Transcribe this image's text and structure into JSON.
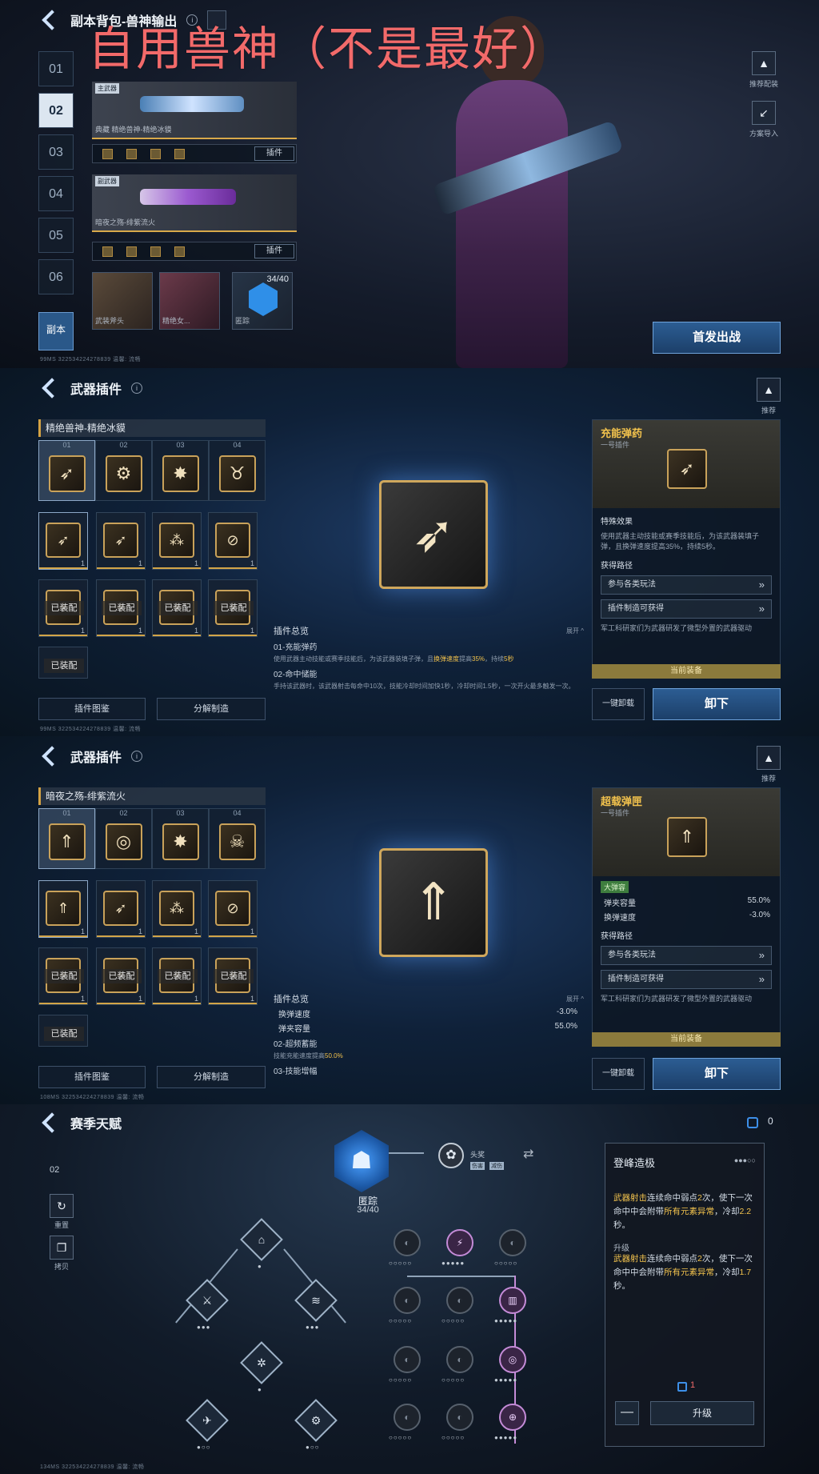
{
  "overlay_title": "自用兽神（不是最好）",
  "p1": {
    "title": "副本背包-兽神输出",
    "slots": [
      "01",
      "02",
      "03",
      "04",
      "05",
      "06"
    ],
    "weapon1": {
      "tag": "主武器",
      "name": "典藏 精绝兽神-精绝冰貘",
      "plugin_btn": "插件"
    },
    "weapon2": {
      "tag": "副武器",
      "name": "暗夜之殇-绯紫流火",
      "plugin_btn": "插件"
    },
    "minis": [
      {
        "label": "武装斧头"
      },
      {
        "label": "精绝女..."
      },
      {
        "label": "匿踪"
      }
    ],
    "mini_count": "34/40",
    "side_recommend": "推荐配装",
    "side_import": "方案导入",
    "dungeon_btn": "副本",
    "fight_btn": "首发出战",
    "footer": "99MS 322534224278839   温馨: 流畅"
  },
  "p2": {
    "title": "武器插件",
    "recommend": "推荐",
    "weapon_label": "精绝兽神-精绝冰貘",
    "tabs": [
      "01",
      "02",
      "03",
      "04"
    ],
    "equipped_label": "已装配",
    "btn_atlas": "插件图鉴",
    "btn_craft": "分解制造",
    "summary_title": "插件总览",
    "expand": "展开 ^",
    "sum1_title": "01-充能弹药",
    "sum1_text_a": "使用武器主动技能或赛季技能后，为该武器装填子弹，且",
    "sum1_hl": "换弹速度",
    "sum1_text_b": "提高",
    "sum1_val": "35%",
    "sum1_text_c": "，持续",
    "sum1_dur": "5秒",
    "sum2_title": "02-命中储能",
    "sum2_text": "手持该武器时，该武器射击每命中10次，技能冷却时间加快1秒，冷却时间1.5秒，一次开火最多触发一次。",
    "detail_name": "充能弹药",
    "detail_sub": "一号插件",
    "sec_effect": "特殊效果",
    "effect_text": "使用武器主动技能或赛季技能后，为该武器装填子弹，且换弹速度提高35%，持续5秒。",
    "sec_source": "获得路径",
    "src1": "参与各类玩法",
    "src2": "插件制造可获得",
    "lore": "军工科研家们为武器研发了微型外置的武器驱动",
    "current": "当前装备",
    "onekey": "一键卸载",
    "unload": "卸下",
    "footer": "99MS 322534224278839   温馨: 流畅"
  },
  "p3": {
    "title": "武器插件",
    "recommend": "推荐",
    "weapon_label": "暗夜之殇-绯紫流火",
    "tabs": [
      "01",
      "02",
      "03",
      "04"
    ],
    "equipped_label": "已装配",
    "btn_atlas": "插件图鉴",
    "btn_craft": "分解制造",
    "summary_title": "插件总览",
    "expand": "展开 ^",
    "stat1_name": "换弹速度",
    "stat1_val": "-3.0%",
    "stat2_name": "弹夹容量",
    "stat2_val": "55.0%",
    "sum2_title": "02-超频蓄能",
    "sum2_text_a": "技能充能速度提高",
    "sum2_val": "50.0%",
    "sum3_title": "03-技能增幅",
    "detail_name": "超载弹匣",
    "detail_sub": "一号插件",
    "tag": "大弹容",
    "d_stat1_name": "弹夹容量",
    "d_stat1_val": "55.0%",
    "d_stat2_name": "换弹速度",
    "d_stat2_val": "-3.0%",
    "sec_source": "获得路径",
    "src1": "参与各类玩法",
    "src2": "插件制造可获得",
    "lore": "军工科研家们为武器研发了微型外置的武器驱动",
    "current": "当前装备",
    "onekey": "一键卸载",
    "unload": "卸下",
    "footer": "108MS 322534224278839   温馨: 流畅"
  },
  "p4": {
    "title": "赛季天赋",
    "points": "0",
    "side_count": "02",
    "reset": "重置",
    "copy": "拷贝",
    "hood_name": "匿踪",
    "hood_count": "34/40",
    "reward_label": "头奖",
    "reward_tags": [
      "伤害",
      "减伤"
    ],
    "box_title": "登峰造极",
    "box_dots": "●●●○○",
    "cur_a": "武器射击",
    "cur_b": "连续命中弱点",
    "cur_n": "2",
    "cur_c": "次，使下一次命中中会附带",
    "cur_d": "所有元素异常",
    "cur_e": "，冷却",
    "cur_cd": "2.2",
    "cur_f": "秒。",
    "up_label": "升级",
    "nxt_cd": "1.7",
    "cost": "1",
    "up_btn": "升级",
    "minus": "—",
    "footer": "134MS 322534224278839   温馨: 流畅"
  },
  "icons": {
    "bullets": "➶",
    "shield": "⛨",
    "flame": "🔥"
  }
}
